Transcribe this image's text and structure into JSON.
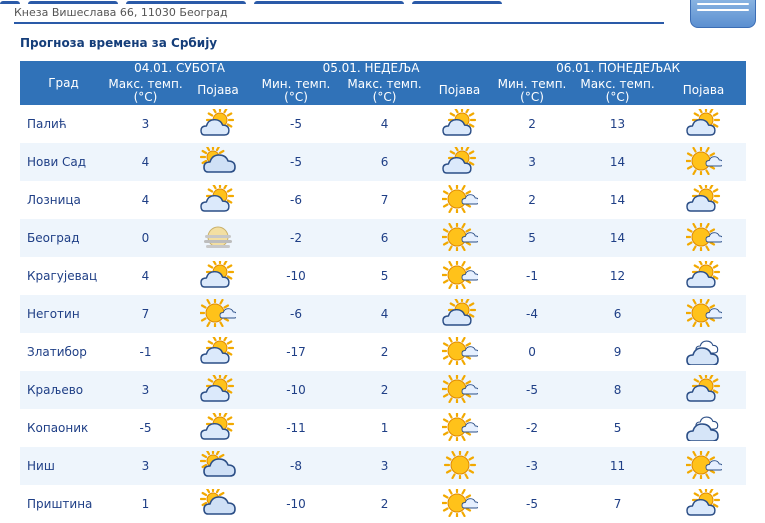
{
  "header": {
    "address": "Кнеза Вишеслава 66, 11030 Београд"
  },
  "section_title": "Прогноза времена за Србију",
  "table": {
    "city_header": "Град",
    "days": [
      {
        "date": "04.01. СУБОТА",
        "columns": [
          "Макс. темп. (°C)",
          "Појава"
        ]
      },
      {
        "date": "05.01. НЕДЕЉА",
        "columns": [
          "Мин. темп. (°C)",
          "Макс. темп. (°C)",
          "Појава"
        ]
      },
      {
        "date": "06.01. ПОНЕДЕЉАК",
        "columns": [
          "Мин. темп. (°C)",
          "Макс. темп. (°C)",
          "Појава"
        ]
      }
    ],
    "rows": [
      {
        "city": "Палић",
        "sat_max": "3",
        "sat_icon": "partly-cloudy-icon",
        "sun_min": "-5",
        "sun_max": "4",
        "sun_icon": "partly-cloudy-icon",
        "mon_min": "2",
        "mon_max": "13",
        "mon_icon": "partly-cloudy-icon"
      },
      {
        "city": "Нови Сад",
        "sat_max": "4",
        "sat_icon": "cloudy-sun-icon",
        "sun_min": "-5",
        "sun_max": "6",
        "sun_icon": "partly-cloudy-icon",
        "mon_min": "3",
        "mon_max": "14",
        "mon_icon": "mostly-sunny-icon"
      },
      {
        "city": "Лозница",
        "sat_max": "4",
        "sat_icon": "partly-cloudy-icon",
        "sun_min": "-6",
        "sun_max": "7",
        "sun_icon": "mostly-sunny-icon",
        "mon_min": "2",
        "mon_max": "14",
        "mon_icon": "partly-cloudy-icon"
      },
      {
        "city": "Београд",
        "sat_max": "0",
        "sat_icon": "fog-icon",
        "sun_min": "-2",
        "sun_max": "6",
        "sun_icon": "mostly-sunny-icon",
        "mon_min": "5",
        "mon_max": "14",
        "mon_icon": "mostly-sunny-icon"
      },
      {
        "city": "Крагујевац",
        "sat_max": "4",
        "sat_icon": "partly-cloudy-icon",
        "sun_min": "-10",
        "sun_max": "5",
        "sun_icon": "mostly-sunny-icon",
        "mon_min": "-1",
        "mon_max": "12",
        "mon_icon": "partly-cloudy-icon"
      },
      {
        "city": "Неготин",
        "sat_max": "7",
        "sat_icon": "mostly-sunny-icon",
        "sun_min": "-6",
        "sun_max": "4",
        "sun_icon": "partly-cloudy-icon",
        "mon_min": "-4",
        "mon_max": "6",
        "mon_icon": "mostly-sunny-icon"
      },
      {
        "city": "Златибор",
        "sat_max": "-1",
        "sat_icon": "partly-cloudy-icon",
        "sun_min": "-17",
        "sun_max": "2",
        "sun_icon": "mostly-sunny-icon",
        "mon_min": "0",
        "mon_max": "9",
        "mon_icon": "cloudy-icon"
      },
      {
        "city": "Краљево",
        "sat_max": "3",
        "sat_icon": "partly-cloudy-icon",
        "sun_min": "-10",
        "sun_max": "2",
        "sun_icon": "mostly-sunny-icon",
        "mon_min": "-5",
        "mon_max": "8",
        "mon_icon": "partly-cloudy-icon"
      },
      {
        "city": "Копаоник",
        "sat_max": "-5",
        "sat_icon": "partly-cloudy-icon",
        "sun_min": "-11",
        "sun_max": "1",
        "sun_icon": "mostly-sunny-icon",
        "mon_min": "-2",
        "mon_max": "5",
        "mon_icon": "cloudy-icon"
      },
      {
        "city": "Ниш",
        "sat_max": "3",
        "sat_icon": "cloudy-sun-icon",
        "sun_min": "-8",
        "sun_max": "3",
        "sun_icon": "sunny-icon",
        "mon_min": "-3",
        "mon_max": "11",
        "mon_icon": "mostly-sunny-icon"
      },
      {
        "city": "Приштина",
        "sat_max": "1",
        "sat_icon": "cloudy-sun-icon",
        "sun_min": "-10",
        "sun_max": "2",
        "sun_icon": "mostly-sunny-icon",
        "mon_min": "-5",
        "mon_max": "7",
        "mon_icon": "partly-cloudy-icon"
      }
    ]
  },
  "colors": {
    "header_blue": "#3072b8",
    "row_alt": "#eef5fc",
    "text_blue": "#1f3f86"
  }
}
